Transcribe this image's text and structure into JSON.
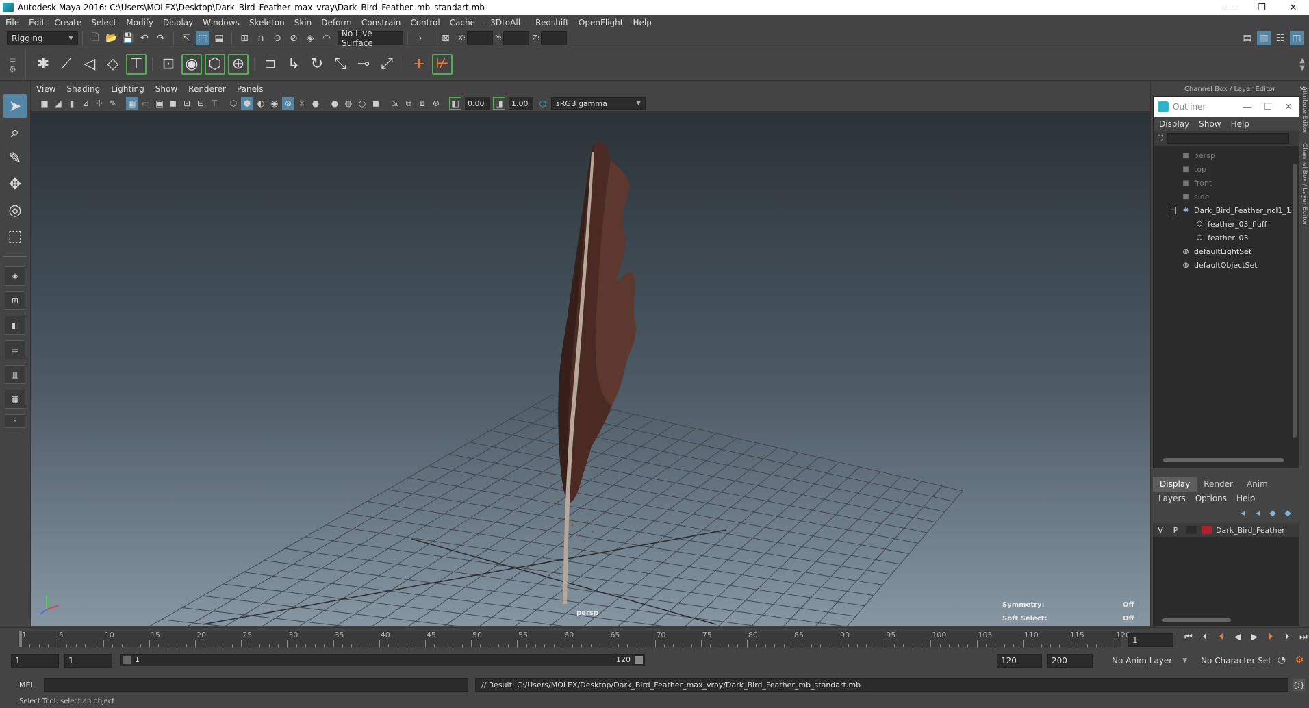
{
  "window": {
    "title": "Autodesk Maya 2016: C:\\Users\\MOLEX\\Desktop\\Dark_Bird_Feather_max_vray\\Dark_Bird_Feather_mb_standart.mb",
    "minimize": "—",
    "restore": "❐",
    "close": "✕"
  },
  "menubar": [
    "File",
    "Edit",
    "Create",
    "Select",
    "Modify",
    "Display",
    "Windows",
    "Skeleton",
    "Skin",
    "Deform",
    "Constrain",
    "Control",
    "Cache",
    "- 3DtoAll -",
    "Redshift",
    "OpenFlight",
    "Help"
  ],
  "statusline": {
    "menu_set": "Rigging",
    "live_surface": "No Live Surface",
    "x_label": "X:",
    "y_label": "Y:",
    "z_label": "Z:"
  },
  "viewport": {
    "menus": [
      "View",
      "Shading",
      "Lighting",
      "Show",
      "Renderer",
      "Panels"
    ],
    "exposure": "0.00",
    "gamma": "1.00",
    "color_space": "sRGB gamma",
    "camera_label": "persp",
    "symmetry_label": "Symmetry:",
    "symmetry_value": "Off",
    "soft_select_label": "Soft Select:",
    "soft_select_value": "Off"
  },
  "right_panel": {
    "header": "Channel Box / Layer Editor",
    "side_tabs": [
      "Attribute Editor",
      "Channel Box / Layer Editor"
    ]
  },
  "outliner": {
    "title": "Outliner",
    "menus": [
      "Display",
      "Show",
      "Help"
    ],
    "items": [
      {
        "label": "persp",
        "dim": true,
        "icon": "camera-icon"
      },
      {
        "label": "top",
        "dim": true,
        "icon": "camera-icon"
      },
      {
        "label": "front",
        "dim": true,
        "icon": "camera-icon"
      },
      {
        "label": "side",
        "dim": true,
        "icon": "camera-icon"
      },
      {
        "label": "Dark_Bird_Feather_ncl1_1",
        "dim": false,
        "icon": "group-icon"
      },
      {
        "label": "feather_03_fluff",
        "dim": false,
        "icon": "mesh-icon"
      },
      {
        "label": "feather_03",
        "dim": false,
        "icon": "mesh-icon"
      },
      {
        "label": "defaultLightSet",
        "dim": false,
        "icon": "set-icon"
      },
      {
        "label": "defaultObjectSet",
        "dim": false,
        "icon": "set-icon"
      }
    ]
  },
  "layer_editor": {
    "tabs": [
      "Display",
      "Render",
      "Anim"
    ],
    "menus": [
      "Layers",
      "Options",
      "Help"
    ],
    "layer": {
      "v": "V",
      "p": "P",
      "name": "Dark_Bird_Feather",
      "color": "#b0202e"
    }
  },
  "timeslider": {
    "ticks": [
      1,
      5,
      10,
      15,
      20,
      25,
      30,
      35,
      40,
      45,
      50,
      55,
      60,
      65,
      70,
      75,
      80,
      85,
      90,
      95,
      100,
      105,
      110,
      115,
      120
    ],
    "current_frame": "1"
  },
  "rangeslider": {
    "start": "1",
    "playback_start": "1",
    "range_start_label": "1",
    "range_end_label": "120",
    "playback_end": "120",
    "end": "200",
    "anim_layer": "No Anim Layer",
    "character_set": "No Character Set"
  },
  "cmdline": {
    "label": "MEL",
    "result": "// Result: C:/Users/MOLEX/Desktop/Dark_Bird_Feather_max_vray/Dark_Bird_Feather_mb_standart.mb"
  },
  "helpline": "Select Tool: select an object",
  "colors": {
    "accent": "#5285a6",
    "feather": "#4a2a22",
    "layer_red": "#b0202e",
    "shelf_green": "#4caf50"
  }
}
